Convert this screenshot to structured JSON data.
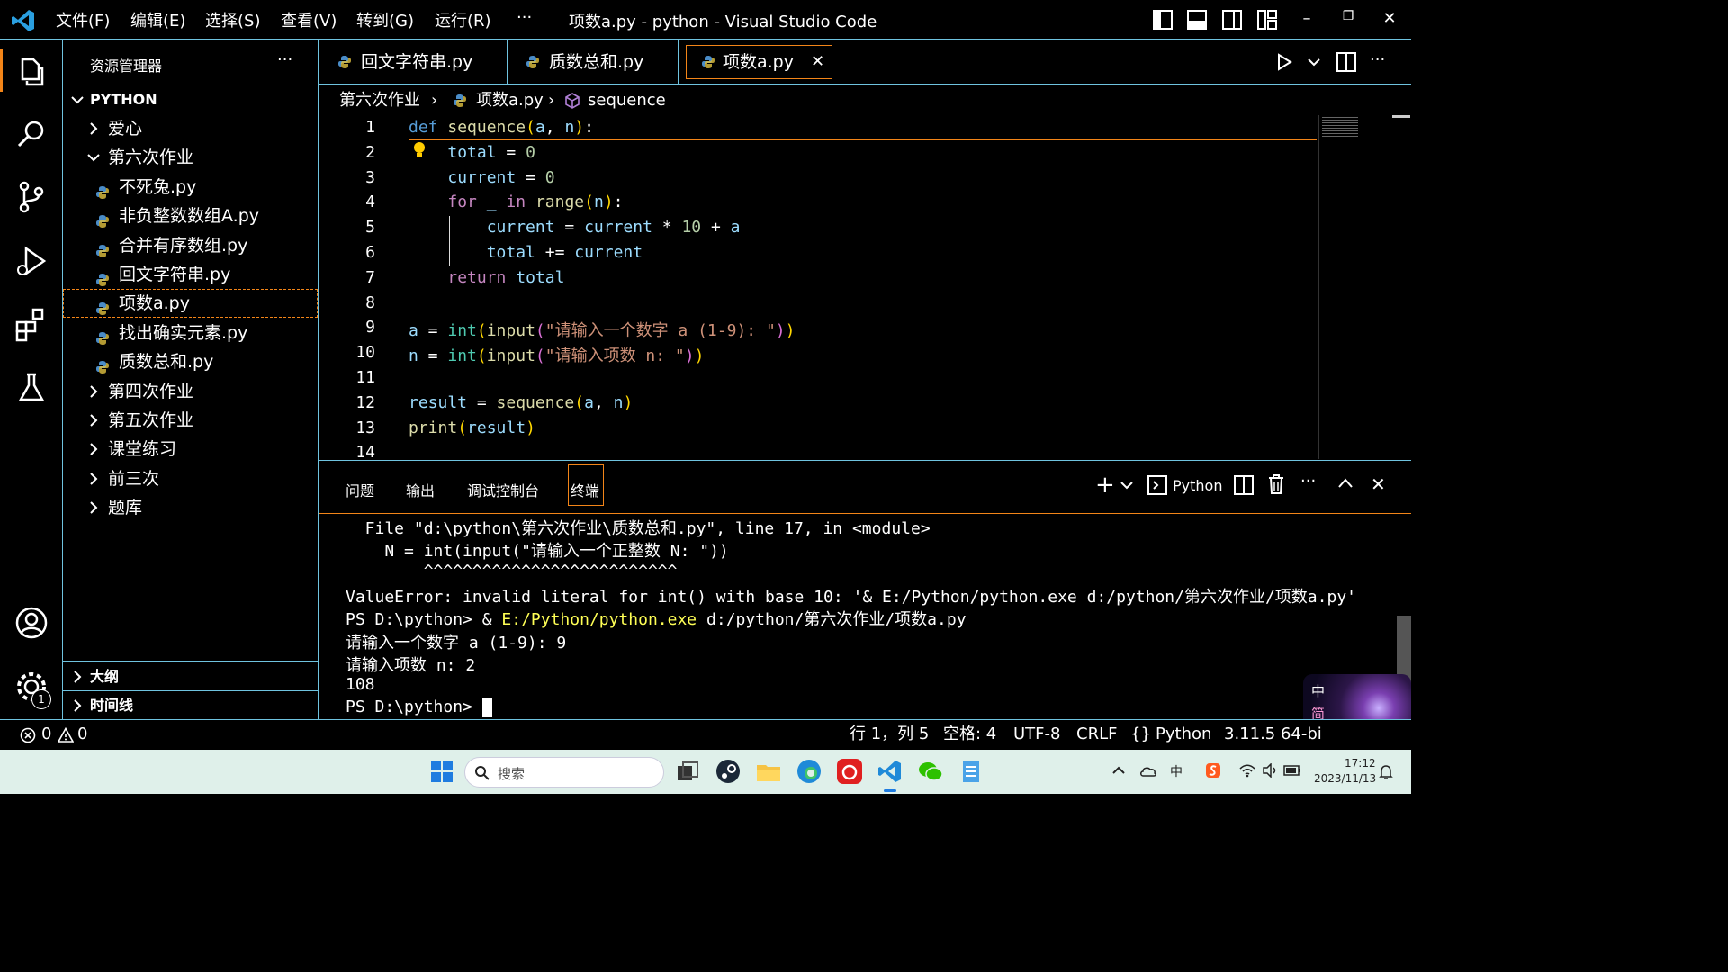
{
  "titlebar": {
    "menus": [
      "文件(F)",
      "编辑(E)",
      "选择(S)",
      "查看(V)",
      "转到(G)",
      "运行(R)",
      "···"
    ],
    "title": "项数a.py - python - Visual Studio Code",
    "window_controls": [
      "minimize-icon",
      "restore-icon",
      "close-icon"
    ]
  },
  "activity_bar": {
    "items": [
      "explorer-icon",
      "search-icon",
      "source-control-icon",
      "run-debug-icon",
      "extensions-icon",
      "testing-icon"
    ],
    "bottom": [
      "accounts-icon",
      "manage-gear-icon"
    ],
    "manage_badge": "1"
  },
  "sidebar": {
    "header": "资源管理器",
    "more": "···",
    "root": "PYTHON",
    "tree": [
      {
        "label": "爱心",
        "type": "folder",
        "expanded": false,
        "depth": 1
      },
      {
        "label": "第六次作业",
        "type": "folder",
        "expanded": true,
        "depth": 1
      },
      {
        "label": "不死兔.py",
        "type": "file",
        "depth": 2
      },
      {
        "label": "非负整数数组A.py",
        "type": "file",
        "depth": 2
      },
      {
        "label": "合并有序数组.py",
        "type": "file",
        "depth": 2
      },
      {
        "label": "回文字符串.py",
        "type": "file",
        "depth": 2
      },
      {
        "label": "项数a.py",
        "type": "file",
        "depth": 2,
        "selected": true
      },
      {
        "label": "找出确实元素.py",
        "type": "file",
        "depth": 2
      },
      {
        "label": "质数总和.py",
        "type": "file",
        "depth": 2
      },
      {
        "label": "第四次作业",
        "type": "folder",
        "expanded": false,
        "depth": 1
      },
      {
        "label": "第五次作业",
        "type": "folder",
        "expanded": false,
        "depth": 1
      },
      {
        "label": "课堂练习",
        "type": "folder",
        "expanded": false,
        "depth": 1
      },
      {
        "label": "前三次",
        "type": "folder",
        "expanded": false,
        "depth": 1
      },
      {
        "label": "题库",
        "type": "folder",
        "expanded": false,
        "depth": 1
      }
    ],
    "outline": "大纲",
    "timeline": "时间线"
  },
  "tabs": [
    {
      "label": "回文字符串.py",
      "active": false
    },
    {
      "label": "质数总和.py",
      "active": false
    },
    {
      "label": "项数a.py",
      "active": true
    }
  ],
  "breadcrumb": [
    "第六次作业",
    "项数a.py",
    "sequence"
  ],
  "code": {
    "line_numbers": [
      "1",
      "2",
      "3",
      "4",
      "5",
      "6",
      "7",
      "8",
      "9",
      "10",
      "11",
      "12",
      "13",
      "14"
    ],
    "lines": [
      "def sequence(a, n):",
      "    total = 0",
      "    current = 0",
      "    for _ in range(n):",
      "        current = current * 10 + a",
      "        total += current",
      "    return total",
      "",
      "a = int(input(\"请输入一个数字 a (1-9): \"))",
      "n = int(input(\"请输入项数 n: \"))",
      "",
      "result = sequence(a, n)",
      "print(result)",
      ""
    ]
  },
  "panel": {
    "tabs": [
      "问题",
      "输出",
      "调试控制台",
      "终端"
    ],
    "active_tab": "终端",
    "terminal_name": "Python",
    "terminal_lines": [
      "  File \"d:\\python\\第六次作业\\质数总和.py\", line 17, in <module>",
      "    N = int(input(\"请输入一个正整数 N: \"))",
      "        ^^^^^^^^^^^^^^^^^^^^^^^^^^",
      "ValueError: invalid literal for int() with base 10: '& E:/Python/python.exe d:/python/第六次作业/项数a.py'",
      "PS D:\\python> & ",
      "请输入一个数字 a (1-9): 9",
      "请输入项数 n: 2",
      "108",
      "PS D:\\python> "
    ],
    "cmd_exe": "E:/Python/python.exe",
    "cmd_arg": " d:/python/第六次作业/项数a.py"
  },
  "statusbar": {
    "errors": "0",
    "warnings": "0",
    "position": "行 1，列 5",
    "spaces": "空格: 4",
    "encoding": "UTF-8",
    "eol": "CRLF",
    "language": "Python",
    "interpreter": "3.11.5 64-bi"
  },
  "ime": {
    "mode": "中",
    "variant": "简"
  },
  "taskbar": {
    "search_placeholder": "搜索",
    "time": "17:12",
    "date": "2023/11/13",
    "tray_ime": "中",
    "apps": [
      "windows-start-icon",
      "search-icon",
      "task-view-icon",
      "steam-icon",
      "file-explorer-icon",
      "edge-icon",
      "netease-music-icon",
      "vscode-icon",
      "wechat-icon",
      "notepad-icon"
    ]
  },
  "colors": {
    "accent_border": "#6fc3df",
    "focus_border": "#f38518",
    "taskbar_bg": "#dff0ea"
  }
}
